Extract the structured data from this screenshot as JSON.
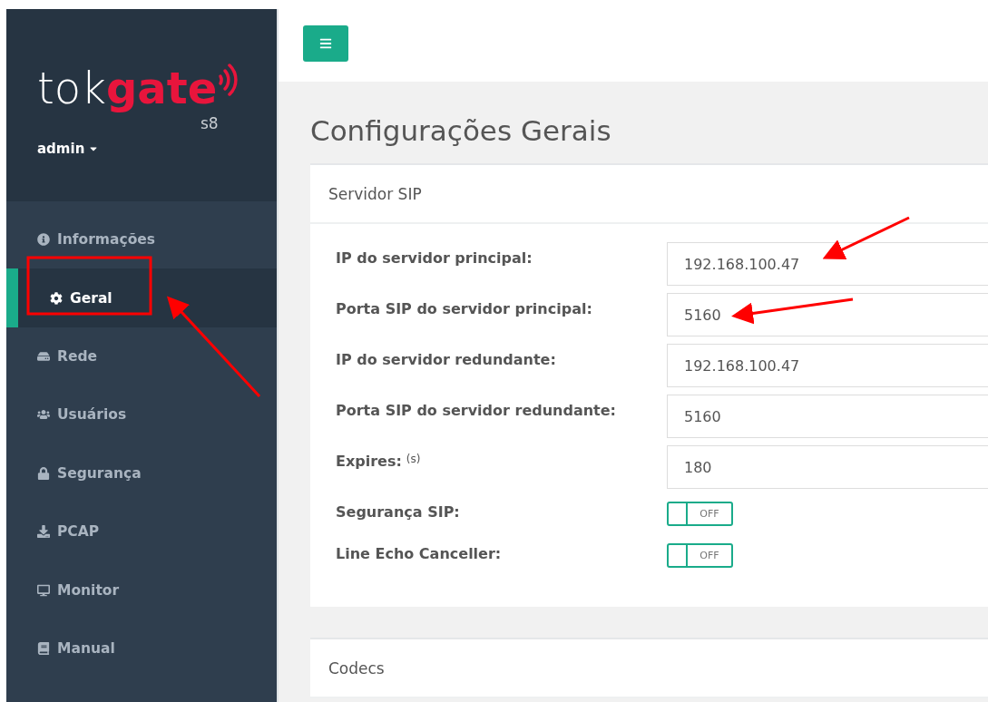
{
  "logo": {
    "part_1": "tok",
    "part_2": "gate",
    "model": "s8"
  },
  "user_menu": {
    "label": "admin"
  },
  "sidebar": {
    "items": [
      {
        "label": "Informações",
        "selected": false
      },
      {
        "label": "Geral",
        "selected": true
      },
      {
        "label": "Rede",
        "selected": false
      },
      {
        "label": "Usuários",
        "selected": false
      },
      {
        "label": "Segurança",
        "selected": false
      },
      {
        "label": "PCAP",
        "selected": false
      },
      {
        "label": "Monitor",
        "selected": false
      },
      {
        "label": "Manual",
        "selected": false
      }
    ]
  },
  "page_title": "Configurações Gerais",
  "panels": [
    {
      "title": "Servidor SIP",
      "rows": [
        {
          "kind": "text",
          "label": "IP do servidor principal:",
          "value": "192.168.100.47"
        },
        {
          "kind": "text",
          "label": "Porta SIP do servidor principal:",
          "value": "5160"
        },
        {
          "kind": "text",
          "label": "IP do servidor redundante:",
          "value": "192.168.100.47"
        },
        {
          "kind": "text",
          "label": "Porta SIP do servidor redundante:",
          "value": "5160"
        },
        {
          "kind": "text",
          "label": "Expires:",
          "unit": "(s)",
          "value": "180"
        },
        {
          "kind": "switch",
          "label": "Segurança SIP:",
          "on": false,
          "off_text": "OFF"
        },
        {
          "kind": "switch",
          "label": "Line Echo Canceller:",
          "on": false,
          "off_text": "OFF"
        }
      ]
    },
    {
      "title": "Codecs"
    }
  ]
}
